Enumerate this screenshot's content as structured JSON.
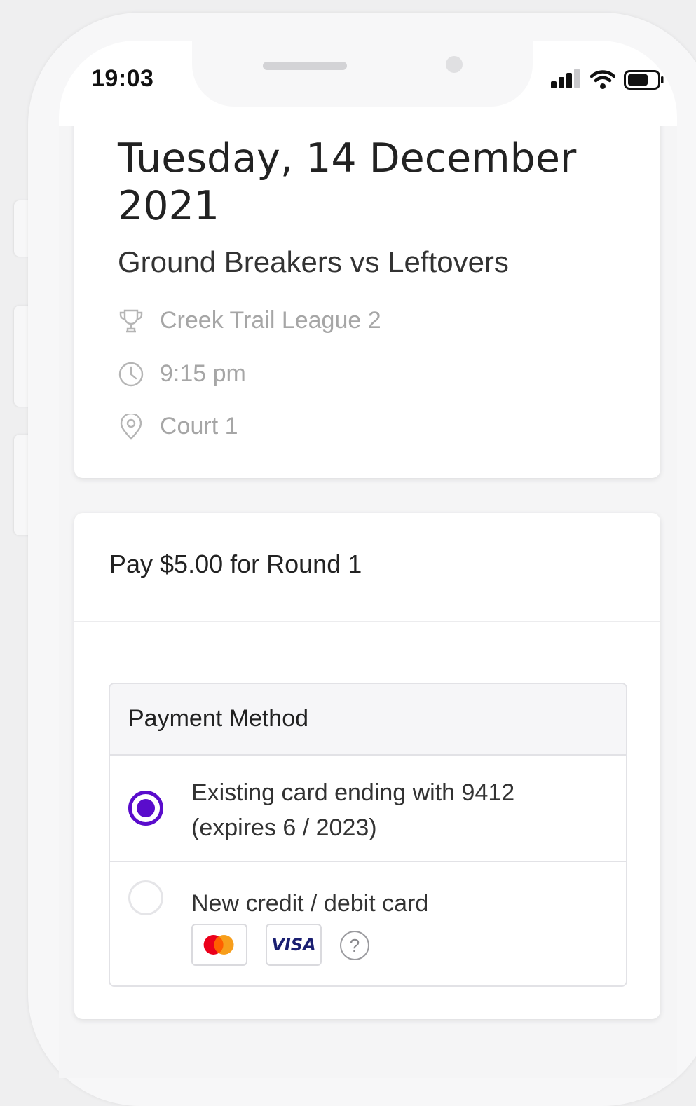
{
  "status_bar": {
    "time": "19:03"
  },
  "event": {
    "date": "Tuesday, 14 December 2021",
    "match": "Ground Breakers vs Leftovers",
    "league": "Creek Trail League 2",
    "time": "9:15 pm",
    "location": "Court 1"
  },
  "payment": {
    "title": "Pay $5.00 for Round 1",
    "method_header": "Payment Method",
    "options": [
      {
        "line1": "Existing card ending with 9412",
        "line2": "(expires 6 / 2023)",
        "selected": true
      },
      {
        "line1": "New credit / debit card",
        "selected": false
      }
    ],
    "card_brands": [
      "mastercard-icon",
      "visa-icon"
    ],
    "visa_text": "VISA",
    "help_symbol": "?"
  },
  "colors": {
    "accent": "#5a0ccc",
    "muted_text": "#a6a6a6"
  },
  "icons": [
    "trophy-icon",
    "clock-icon",
    "location-pin-icon",
    "signal-icon",
    "wifi-icon",
    "battery-icon"
  ]
}
